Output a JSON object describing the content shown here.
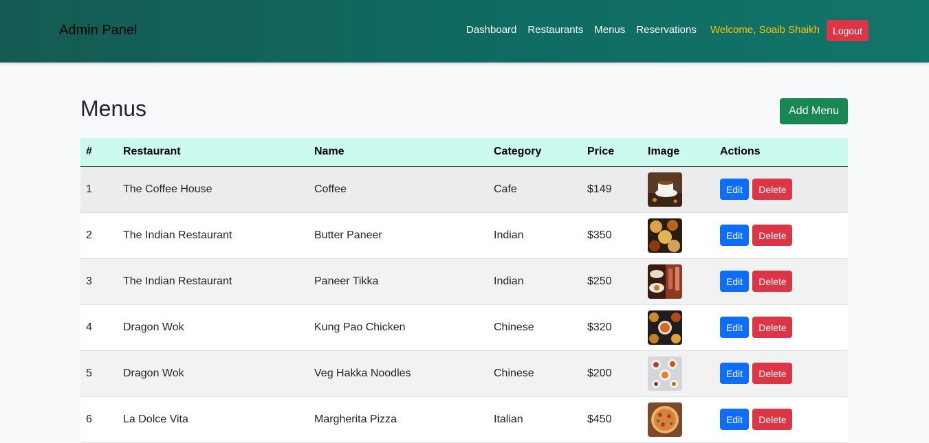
{
  "navbar": {
    "brand": "Admin Panel",
    "links": [
      "Dashboard",
      "Restaurants",
      "Menus",
      "Reservations"
    ],
    "welcome": "Welcome, Soaib Shaikh",
    "logout_label": "Logout"
  },
  "page": {
    "title": "Menus",
    "add_label": "Add Menu"
  },
  "table": {
    "headers": [
      "#",
      "Restaurant",
      "Name",
      "Category",
      "Price",
      "Image",
      "Actions"
    ],
    "edit_label": "Edit",
    "delete_label": "Delete",
    "rows": [
      {
        "id": "1",
        "restaurant": "The Coffee House",
        "name": "Coffee",
        "category": "Cafe",
        "price": "$149",
        "image": "coffee-photo"
      },
      {
        "id": "2",
        "restaurant": "The Indian Restaurant",
        "name": "Butter Paneer",
        "category": "Indian",
        "price": "$350",
        "image": "indian-dishes-photo"
      },
      {
        "id": "3",
        "restaurant": "The Indian Restaurant",
        "name": "Paneer Tikka",
        "category": "Indian",
        "price": "$250",
        "image": "restaurant-table-photo"
      },
      {
        "id": "4",
        "restaurant": "Dragon Wok",
        "name": "Kung Pao Chicken",
        "category": "Chinese",
        "price": "$320",
        "image": "chinese-bowls-photo"
      },
      {
        "id": "5",
        "restaurant": "Dragon Wok",
        "name": "Veg Hakka Noodles",
        "category": "Chinese",
        "price": "$200",
        "image": "noodle-plates-photo"
      },
      {
        "id": "6",
        "restaurant": "La Dolce Vita",
        "name": "Margherita Pizza",
        "category": "Italian",
        "price": "$450",
        "image": "pizza-photo"
      }
    ]
  },
  "colors": {
    "navbar_start": "#145a52",
    "navbar_end": "#127569",
    "welcome": "#ffc107",
    "danger": "#dc3545",
    "primary": "#0d6efd",
    "success": "#198754",
    "table_header": "#ccfaef"
  }
}
